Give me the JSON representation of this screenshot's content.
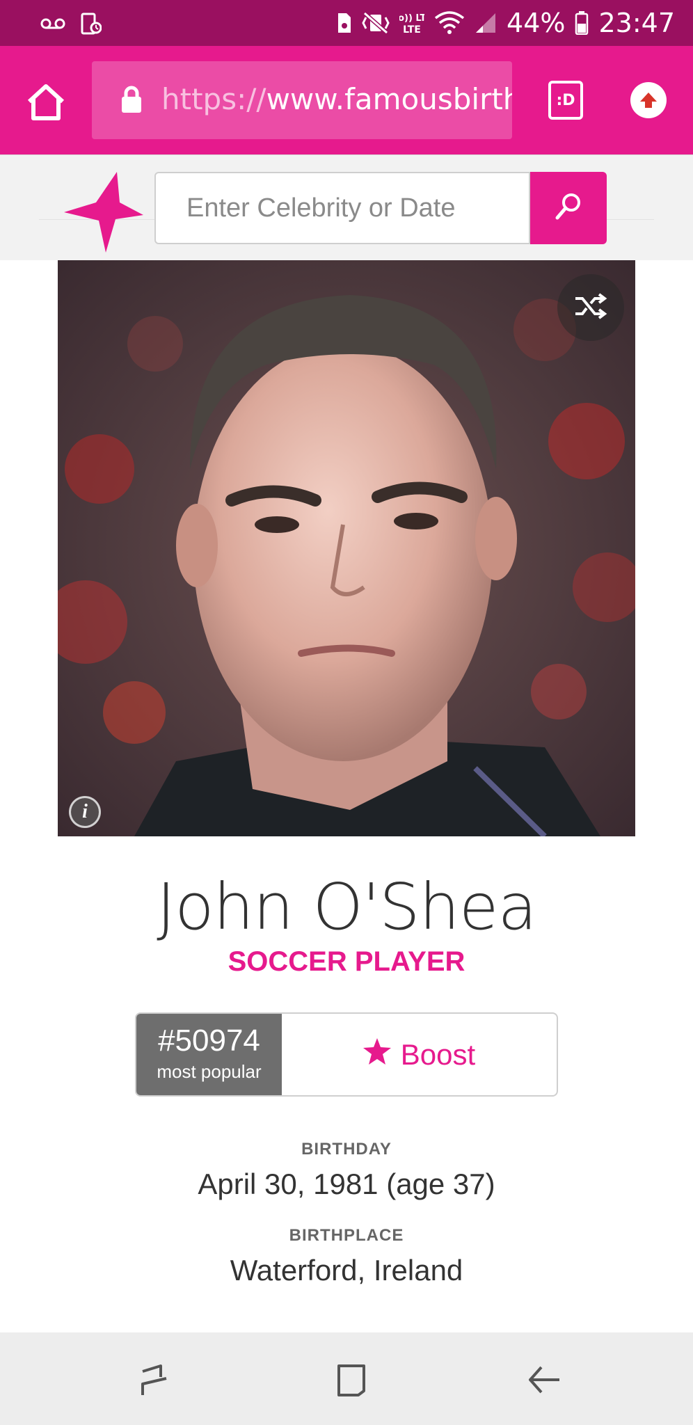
{
  "status_bar": {
    "battery_percent": "44%",
    "time": "23:47",
    "volte_label": "Vo)) LTE",
    "icons": [
      "voicemail-icon",
      "screen-lock-icon",
      "android-sd-icon",
      "vibrate-mute-icon",
      "volte-icon",
      "wifi-icon",
      "signal-icon",
      "battery-icon"
    ]
  },
  "browser": {
    "url_protocol": "https://",
    "url_rest": "www.famousbirth",
    "tabs_label": ":D",
    "icons": [
      "home-icon",
      "lock-icon",
      "tabs-icon",
      "upload-icon"
    ]
  },
  "site": {
    "search_placeholder": "Enter Celebrity or Date",
    "brand_color": "#e61a8d",
    "icons": [
      "star-logo-icon",
      "search-icon"
    ]
  },
  "photo": {
    "icons": [
      "shuffle-icon",
      "info-icon"
    ],
    "info_glyph": "i"
  },
  "profile": {
    "name": "John O'Shea",
    "profession": "SOCCER PLAYER",
    "rank": "#50974",
    "rank_label": "most popular",
    "boost_label": "Boost",
    "birthday_label": "BIRTHDAY",
    "birthday_value": "April 30, 1981 (age 37)",
    "birthplace_label": "BIRTHPLACE",
    "birthplace_value": "Waterford, Ireland"
  },
  "nav_bar": {
    "icons": [
      "recents-icon",
      "home-square-icon",
      "back-icon"
    ]
  }
}
